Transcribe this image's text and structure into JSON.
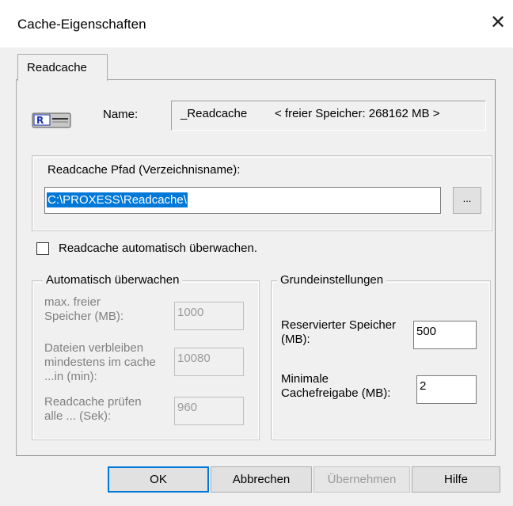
{
  "window": {
    "title": "Cache-Eigenschaften",
    "close_glyph": "✕"
  },
  "tabs": [
    {
      "label": "Readcache",
      "active": true
    }
  ],
  "name_section": {
    "icon": "drive-icon",
    "label": "Name:",
    "value": "_Readcache",
    "free_space": "< freier Speicher:  268162 MB >"
  },
  "path_section": {
    "legend": "Readcache Pfad (Verzeichnisname):",
    "value": "C:\\PROXESS\\Readcache\\",
    "browse_label": "..."
  },
  "auto_monitor": {
    "checkbox_label": "Readcache automatisch überwachen.",
    "checked": false
  },
  "automatisch_group": {
    "legend": "Automatisch überwachen",
    "fields": [
      {
        "label": "max. freier Speicher (MB):",
        "value": "1000"
      },
      {
        "label": "Dateien verbleiben mindestens im cache ...in (min):",
        "value": "10080"
      },
      {
        "label": "Readcache prüfen alle ... (Sek):",
        "value": "960"
      }
    ]
  },
  "grund_group": {
    "legend": "Grundeinstellungen",
    "fields": [
      {
        "label": "Reservierter Speicher (MB):",
        "value": "500"
      },
      {
        "label": "Minimale Cachefreigabe (MB):",
        "value": "2"
      }
    ]
  },
  "buttons": {
    "ok": "OK",
    "cancel": "Abbrechen",
    "apply": "Übernehmen",
    "help": "Hilfe"
  },
  "colors": {
    "selection": "#0078d7",
    "dialog_bg": "#f0f0f0"
  }
}
